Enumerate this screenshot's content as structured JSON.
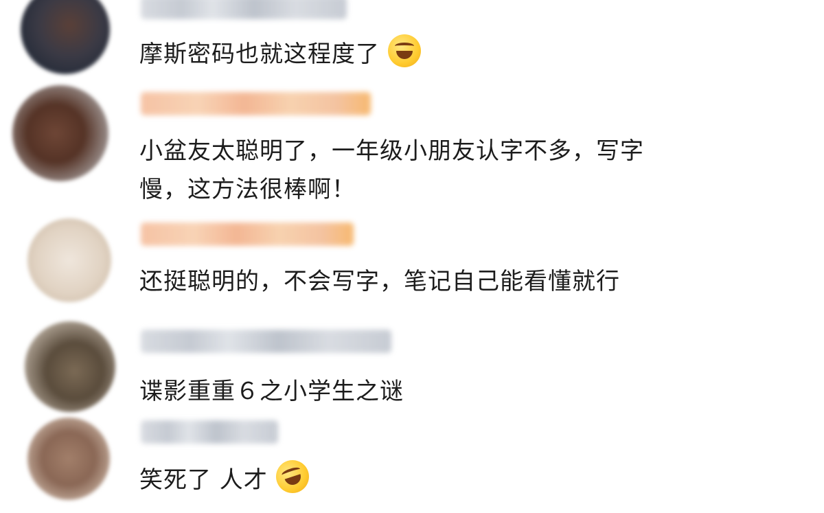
{
  "comments": [
    {
      "text": "摩斯密码也就这程度了",
      "username_style": "gray",
      "emoji": "laughing-tears-icon"
    },
    {
      "text_line1": "小盆友太聪明了，一年级小朋友认字不多，写字",
      "text_line2": "慢，这方法很棒啊！",
      "username_style": "orange"
    },
    {
      "text": "还挺聪明的，不会写字，笔记自己能看懂就行",
      "username_style": "orange"
    },
    {
      "text": "谍影重重６之小学生之谜",
      "username_style": "gray"
    },
    {
      "text": "笑死了  人才",
      "username_style": "gray",
      "emoji": "rolling-laughing-icon"
    }
  ],
  "colors": {
    "text": "#1c1c1c",
    "background": "#ffffff",
    "emoji": "#ffcb2f"
  }
}
